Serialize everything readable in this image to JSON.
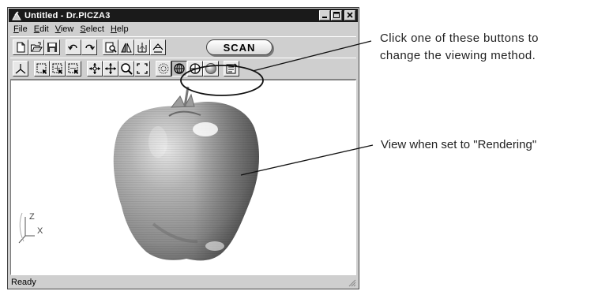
{
  "window": {
    "title": "Untitled - Dr.PICZA3",
    "controls": [
      "minimize-icon",
      "maximize-icon",
      "close-icon"
    ]
  },
  "menubar": {
    "items": [
      {
        "label": "File",
        "mnemonic": "F",
        "rest": "ile"
      },
      {
        "label": "Edit",
        "mnemonic": "E",
        "rest": "dit"
      },
      {
        "label": "View",
        "mnemonic": "V",
        "rest": "iew"
      },
      {
        "label": "Select",
        "mnemonic": "S",
        "rest": "elect"
      },
      {
        "label": "Help",
        "mnemonic": "H",
        "rest": "elp"
      }
    ]
  },
  "toolbar1": {
    "icons": [
      "new-file-icon",
      "open-folder-icon",
      "save-disk-icon",
      "undo-icon",
      "redo-icon",
      "print-preview-icon",
      "mirror-icon",
      "mesh-tool-icon",
      "surface-icon"
    ],
    "scan_label": "SCAN"
  },
  "toolbar2": {
    "icons": [
      "axes-icon",
      "select-region-icon",
      "select-plus-icon",
      "select-minus-icon",
      "move-icon",
      "pan-icon",
      "zoom-icon",
      "fit-icon",
      "view-points-icon",
      "view-wireframe-icon",
      "view-shaded-icon",
      "view-rendering-icon",
      "properties-icon"
    ],
    "pressed": "view-shaded-icon"
  },
  "viewport": {
    "axis_labels": {
      "z": "Z",
      "x": "X"
    },
    "object": "apple-render"
  },
  "status": {
    "text": "Ready"
  },
  "annotations": {
    "buttons_line1": "Click one of these buttons to",
    "buttons_line2": "change the viewing method.",
    "rendering": "View when set to \"Rendering\""
  },
  "colors": {
    "titlebar": "#1a1a1a",
    "window_face": "#cfcfcf",
    "viewport": "#ffffff",
    "apple": "#9c9c9c"
  }
}
